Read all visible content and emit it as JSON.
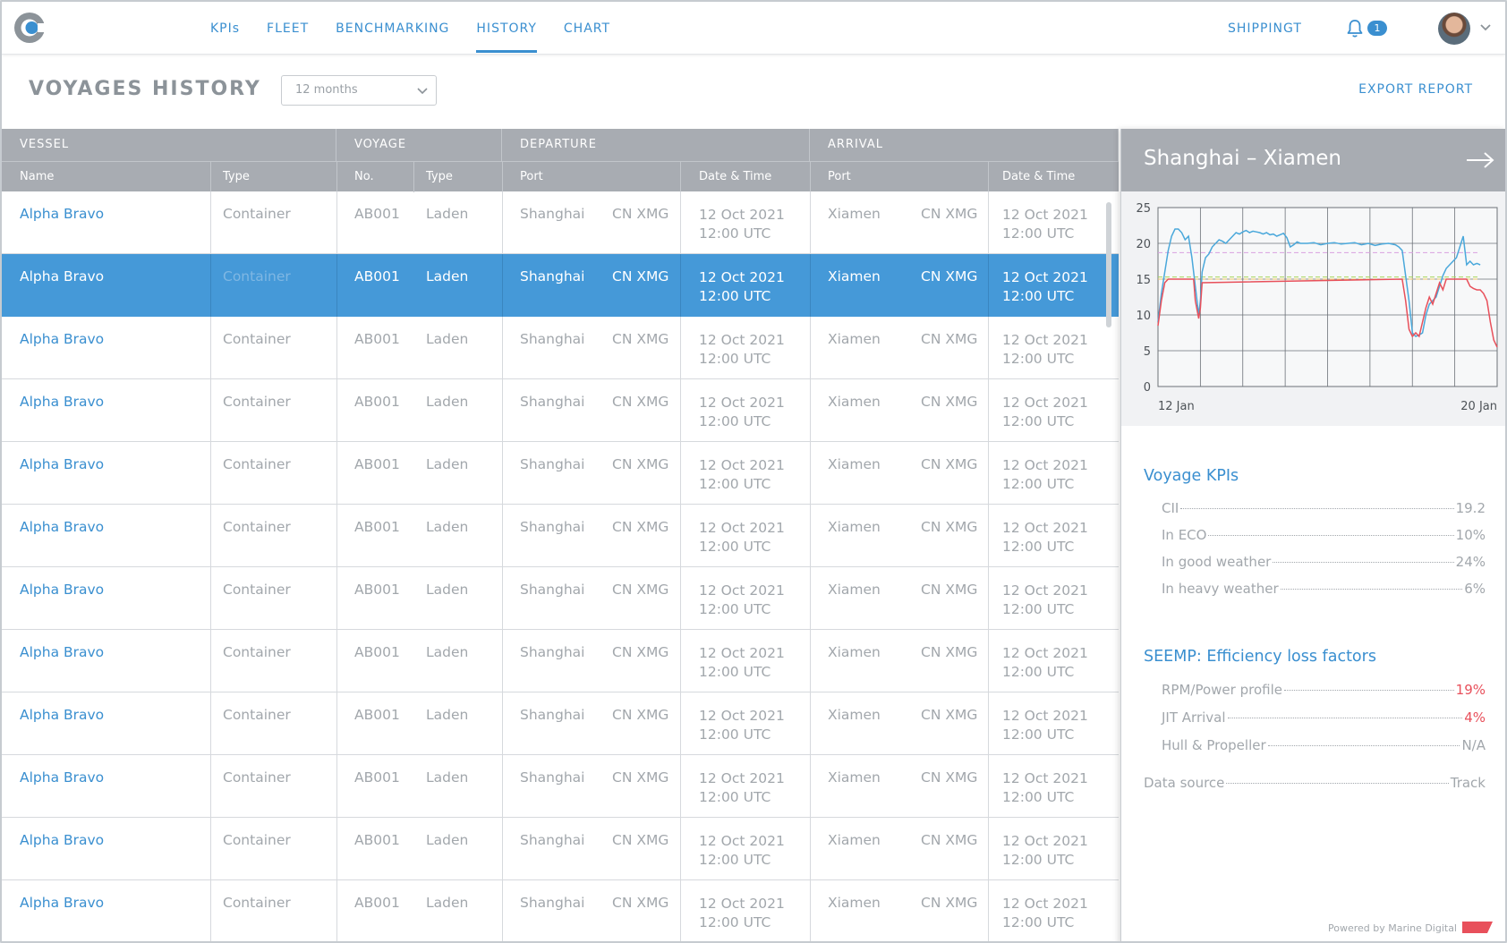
{
  "nav": {
    "items": [
      {
        "label": "KPIs",
        "active": false
      },
      {
        "label": "FLEET",
        "active": false
      },
      {
        "label": "BENCHMARKING",
        "active": false
      },
      {
        "label": "HISTORY",
        "active": true
      },
      {
        "label": "CHART",
        "active": false
      }
    ],
    "company": "SHIPPINGT",
    "notification_count": "1",
    "accent_color": "#3a8fd0"
  },
  "header": {
    "title": "VOYAGES HISTORY",
    "period_select": "12 months",
    "export_label": "EXPORT REPORT"
  },
  "table": {
    "groups": [
      "VESSEL",
      "VOYAGE",
      "DEPARTURE",
      "ARRIVAL"
    ],
    "columns": [
      "Name",
      "Type",
      "No.",
      "Type",
      "Port",
      "Date & Time",
      "Port",
      "Date & Time"
    ],
    "selected_row": 1,
    "rows": [
      {
        "name": "Alpha Bravo",
        "vtype": "Container",
        "no": "AB001",
        "ltype": "Laden",
        "dep_port": "Shanghai",
        "dep_code": "CN XMG",
        "dep_date": "12 Oct 2021",
        "dep_time": "12:00 UTC",
        "arr_port": "Xiamen",
        "arr_code": "CN XMG",
        "arr_date": "12 Oct 2021",
        "arr_time": "12:00 UTC"
      },
      {
        "name": "Alpha Bravo",
        "vtype": "Container",
        "no": "AB001",
        "ltype": "Laden",
        "dep_port": "Shanghai",
        "dep_code": "CN XMG",
        "dep_date": "12 Oct 2021",
        "dep_time": "12:00 UTC",
        "arr_port": "Xiamen",
        "arr_code": "CN XMG",
        "arr_date": "12 Oct 2021",
        "arr_time": "12:00 UTC"
      },
      {
        "name": "Alpha Bravo",
        "vtype": "Container",
        "no": "AB001",
        "ltype": "Laden",
        "dep_port": "Shanghai",
        "dep_code": "CN XMG",
        "dep_date": "12 Oct 2021",
        "dep_time": "12:00 UTC",
        "arr_port": "Xiamen",
        "arr_code": "CN XMG",
        "arr_date": "12 Oct 2021",
        "arr_time": "12:00 UTC"
      },
      {
        "name": "Alpha Bravo",
        "vtype": "Container",
        "no": "AB001",
        "ltype": "Laden",
        "dep_port": "Shanghai",
        "dep_code": "CN XMG",
        "dep_date": "12 Oct 2021",
        "dep_time": "12:00 UTC",
        "arr_port": "Xiamen",
        "arr_code": "CN XMG",
        "arr_date": "12 Oct 2021",
        "arr_time": "12:00 UTC"
      },
      {
        "name": "Alpha Bravo",
        "vtype": "Container",
        "no": "AB001",
        "ltype": "Laden",
        "dep_port": "Shanghai",
        "dep_code": "CN XMG",
        "dep_date": "12 Oct 2021",
        "dep_time": "12:00 UTC",
        "arr_port": "Xiamen",
        "arr_code": "CN XMG",
        "arr_date": "12 Oct 2021",
        "arr_time": "12:00 UTC"
      },
      {
        "name": "Alpha Bravo",
        "vtype": "Container",
        "no": "AB001",
        "ltype": "Laden",
        "dep_port": "Shanghai",
        "dep_code": "CN XMG",
        "dep_date": "12 Oct 2021",
        "dep_time": "12:00 UTC",
        "arr_port": "Xiamen",
        "arr_code": "CN XMG",
        "arr_date": "12 Oct 2021",
        "arr_time": "12:00 UTC"
      },
      {
        "name": "Alpha Bravo",
        "vtype": "Container",
        "no": "AB001",
        "ltype": "Laden",
        "dep_port": "Shanghai",
        "dep_code": "CN XMG",
        "dep_date": "12 Oct 2021",
        "dep_time": "12:00 UTC",
        "arr_port": "Xiamen",
        "arr_code": "CN XMG",
        "arr_date": "12 Oct 2021",
        "arr_time": "12:00 UTC"
      },
      {
        "name": "Alpha Bravo",
        "vtype": "Container",
        "no": "AB001",
        "ltype": "Laden",
        "dep_port": "Shanghai",
        "dep_code": "CN XMG",
        "dep_date": "12 Oct 2021",
        "dep_time": "12:00 UTC",
        "arr_port": "Xiamen",
        "arr_code": "CN XMG",
        "arr_date": "12 Oct 2021",
        "arr_time": "12:00 UTC"
      },
      {
        "name": "Alpha Bravo",
        "vtype": "Container",
        "no": "AB001",
        "ltype": "Laden",
        "dep_port": "Shanghai",
        "dep_code": "CN XMG",
        "dep_date": "12 Oct 2021",
        "dep_time": "12:00 UTC",
        "arr_port": "Xiamen",
        "arr_code": "CN XMG",
        "arr_date": "12 Oct 2021",
        "arr_time": "12:00 UTC"
      },
      {
        "name": "Alpha Bravo",
        "vtype": "Container",
        "no": "AB001",
        "ltype": "Laden",
        "dep_port": "Shanghai",
        "dep_code": "CN XMG",
        "dep_date": "12 Oct 2021",
        "dep_time": "12:00 UTC",
        "arr_port": "Xiamen",
        "arr_code": "CN XMG",
        "arr_date": "12 Oct 2021",
        "arr_time": "12:00 UTC"
      },
      {
        "name": "Alpha Bravo",
        "vtype": "Container",
        "no": "AB001",
        "ltype": "Laden",
        "dep_port": "Shanghai",
        "dep_code": "CN XMG",
        "dep_date": "12 Oct 2021",
        "dep_time": "12:00 UTC",
        "arr_port": "Xiamen",
        "arr_code": "CN XMG",
        "arr_date": "12 Oct 2021",
        "arr_time": "12:00 UTC"
      },
      {
        "name": "Alpha Bravo",
        "vtype": "Container",
        "no": "AB001",
        "ltype": "Laden",
        "dep_port": "Shanghai",
        "dep_code": "CN XMG",
        "dep_date": "12 Oct 2021",
        "dep_time": "12:00 UTC",
        "arr_port": "Xiamen",
        "arr_code": "CN XMG",
        "arr_date": "12 Oct 2021",
        "arr_time": "12:00 UTC"
      }
    ]
  },
  "panel": {
    "title": "Shanghai – Xiamen",
    "kpi_title": "Voyage KPIs",
    "kpis": [
      {
        "label": "CII",
        "value": "19.2",
        "highlight": false
      },
      {
        "label": "In ECO",
        "value": "10%",
        "highlight": false
      },
      {
        "label": "In good weather",
        "value": "24%",
        "highlight": false
      },
      {
        "label": "In heavy weather",
        "value": "6%",
        "highlight": false
      }
    ],
    "seemp_title": "SEEMP: Efficiency loss factors",
    "seemp": [
      {
        "label": "RPM/Power profile",
        "value": "19%",
        "highlight": true
      },
      {
        "label": "JIT Arrival",
        "value": "4%",
        "highlight": true
      },
      {
        "label": "Hull & Propeller",
        "value": "N/A",
        "highlight": false
      }
    ],
    "data_source_label": "Data source",
    "data_source_value": "Track",
    "powered_by": "Powered by Marine Digital"
  },
  "chart_data": {
    "type": "line",
    "yticks": [
      0,
      5,
      10,
      15,
      20,
      25
    ],
    "ylim": [
      0,
      25
    ],
    "xlim": [
      0,
      100
    ],
    "x_tick_labels": [
      {
        "x": 0,
        "label": "12 Jan"
      },
      {
        "x": 100,
        "label": "20 Jan"
      }
    ],
    "grid": true,
    "series": [
      {
        "color": "#4aa8db",
        "points": [
          [
            0,
            9
          ],
          [
            1,
            13
          ],
          [
            2,
            16
          ],
          [
            3,
            19
          ],
          [
            4,
            21
          ],
          [
            5,
            22
          ],
          [
            6,
            22
          ],
          [
            7,
            21.5
          ],
          [
            8,
            20.5
          ],
          [
            9,
            21
          ],
          [
            10,
            18
          ],
          [
            11,
            14
          ],
          [
            12,
            10
          ],
          [
            12.5,
            12
          ],
          [
            13,
            16
          ],
          [
            14,
            18
          ],
          [
            15,
            18.5
          ],
          [
            16,
            19.5
          ],
          [
            17,
            20
          ],
          [
            18,
            20.5
          ],
          [
            19,
            20.3
          ],
          [
            20,
            20
          ],
          [
            21,
            20.5
          ],
          [
            22,
            21
          ],
          [
            23,
            21.5
          ],
          [
            24,
            21.3
          ],
          [
            25,
            21.6
          ],
          [
            26,
            21.8
          ],
          [
            27,
            21.5
          ],
          [
            28,
            21.7
          ],
          [
            29,
            21.6
          ],
          [
            30,
            21.5
          ],
          [
            31,
            21.3
          ],
          [
            32,
            21.5
          ],
          [
            33,
            21.2
          ],
          [
            34,
            21.3
          ],
          [
            35,
            21
          ],
          [
            36,
            21.2
          ],
          [
            37,
            21.4
          ],
          [
            38,
            20.8
          ],
          [
            39,
            19.5
          ],
          [
            40,
            19.8
          ],
          [
            41,
            20.2
          ],
          [
            42,
            20
          ],
          [
            44,
            20
          ],
          [
            46,
            20.1
          ],
          [
            48,
            19.8
          ],
          [
            50,
            20
          ],
          [
            52,
            20.1
          ],
          [
            54,
            19.9
          ],
          [
            56,
            20
          ],
          [
            58,
            20.1
          ],
          [
            60,
            19.8
          ],
          [
            62,
            20
          ],
          [
            64,
            19.7
          ],
          [
            66,
            19.9
          ],
          [
            68,
            20
          ],
          [
            70,
            19.8
          ],
          [
            71,
            19.5
          ],
          [
            72,
            19
          ],
          [
            73,
            15.5
          ],
          [
            74,
            12
          ],
          [
            75,
            7.5
          ],
          [
            76,
            7
          ],
          [
            77,
            7.2
          ],
          [
            78,
            7.5
          ],
          [
            79,
            10
          ],
          [
            80,
            11.5
          ],
          [
            81,
            12
          ],
          [
            82,
            12.5
          ],
          [
            83,
            14
          ],
          [
            84,
            15.5
          ],
          [
            85,
            16.5
          ],
          [
            86,
            17
          ],
          [
            87,
            17.5
          ],
          [
            88,
            18
          ],
          [
            89,
            19.5
          ],
          [
            90,
            21
          ],
          [
            91,
            17
          ],
          [
            92,
            17.5
          ],
          [
            93,
            17
          ],
          [
            94,
            17.2
          ],
          [
            95,
            17
          ]
        ],
        "values_are": "speed"
      },
      {
        "color": "#e8505b",
        "points": [
          [
            0,
            8.5
          ],
          [
            1,
            12
          ],
          [
            2,
            14.5
          ],
          [
            3,
            15
          ],
          [
            10.5,
            15
          ],
          [
            11,
            12
          ],
          [
            12,
            9.5
          ],
          [
            12.5,
            11
          ],
          [
            13,
            14.5
          ],
          [
            72,
            15
          ],
          [
            73,
            12
          ],
          [
            74,
            8
          ],
          [
            75,
            7
          ],
          [
            76,
            7.5
          ],
          [
            77,
            7
          ],
          [
            78,
            9
          ],
          [
            79,
            11
          ],
          [
            80,
            12.5
          ],
          [
            81,
            11.5
          ],
          [
            82,
            13
          ],
          [
            83,
            14.5
          ],
          [
            84,
            13.5
          ],
          [
            85,
            15
          ],
          [
            91,
            15
          ],
          [
            92,
            14
          ],
          [
            93,
            13.7
          ],
          [
            94,
            13.5
          ],
          [
            95,
            13.5
          ],
          [
            96,
            13
          ],
          [
            97,
            12
          ],
          [
            98,
            9
          ],
          [
            99,
            6.5
          ],
          [
            100,
            5.5
          ]
        ]
      }
    ],
    "reference_lines": [
      {
        "y": 18.7,
        "color": "#d9a0e0",
        "style": "dashed"
      },
      {
        "y": 15.3,
        "color": "#a8d65a",
        "style": "dashed"
      },
      {
        "y": 15.0,
        "color": "#f0c66a",
        "style": "dashed"
      }
    ]
  }
}
